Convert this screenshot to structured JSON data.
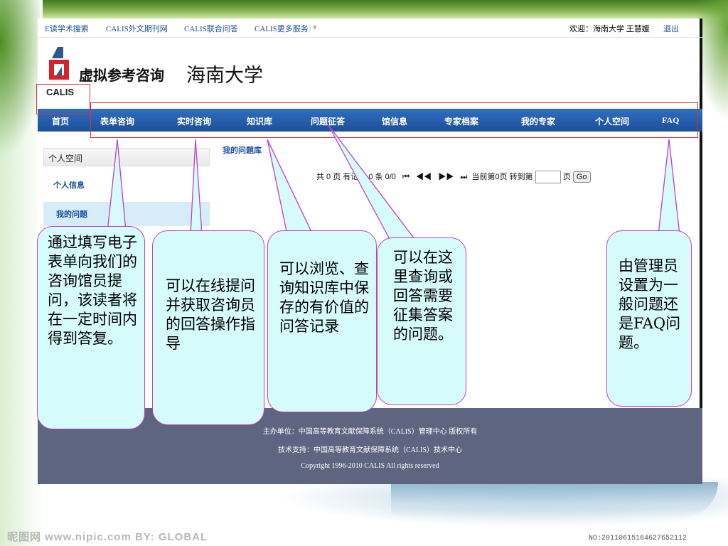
{
  "topbar": {
    "links": [
      "E读学术搜索",
      "CALIS外文期刊网",
      "CALIS联合问答",
      "CALIS更多服务"
    ],
    "more_sep": "| ▾",
    "welcome": "欢迎：海南大学 王慧媛",
    "logout": "退出"
  },
  "header": {
    "logo_text": "CALIS",
    "site_title": "虚拟参考咨询",
    "university": "海南大学"
  },
  "nav": {
    "items": [
      "首页",
      "表单咨询",
      "实时咨询",
      "知识库",
      "问题征答",
      "馆信息",
      "专家档案",
      "我的专家",
      "个人空间",
      "FAQ"
    ]
  },
  "sidebar": {
    "title": "个人空间",
    "items": [
      "个人信息",
      "我的问题"
    ]
  },
  "main": {
    "title": "我的问题库",
    "pager": {
      "summary": "共 0 页  有记录 0 条 0/0",
      "first": "⏮",
      "prev": "◀◀",
      "next": "▶▶",
      "last": "⏭",
      "current": "当前第0页 转到第",
      "page_unit": "页",
      "go": "Go"
    }
  },
  "footer": {
    "line1": "主办单位：中国高等教育文献保障系统（CALIS）管理中心 版权所有",
    "line2": "技术支持：中国高等教育文献保障系统（CALIS）技术中心",
    "line3": "Copyright 1996-2010 CALIS All rights reserved"
  },
  "callouts": {
    "c1": "通过填写电子表单向我们的咨询馆员提问，该读者将在一定时间内得到答复。",
    "c2": "可以在线提问并获取咨询员的回答操作指导",
    "c3": "可以浏览、查询知识库中保存的有价值的问答记录",
    "c4": "可以在这里查询或回答需要征集答案的问题。",
    "c5": "由管理员设置为一般问题还是FAQ问题。"
  },
  "watermark": {
    "site": "昵图网 www.nipic.com   BY: GLOBAL",
    "number": "NO:20110615164627652112"
  },
  "colors": {
    "nav": "#1e4f9a",
    "callout_fill": "#d6fbfb",
    "callout_border": "#c23fc2",
    "highlight_box": "#e0303a",
    "footer": "#5d6580"
  }
}
